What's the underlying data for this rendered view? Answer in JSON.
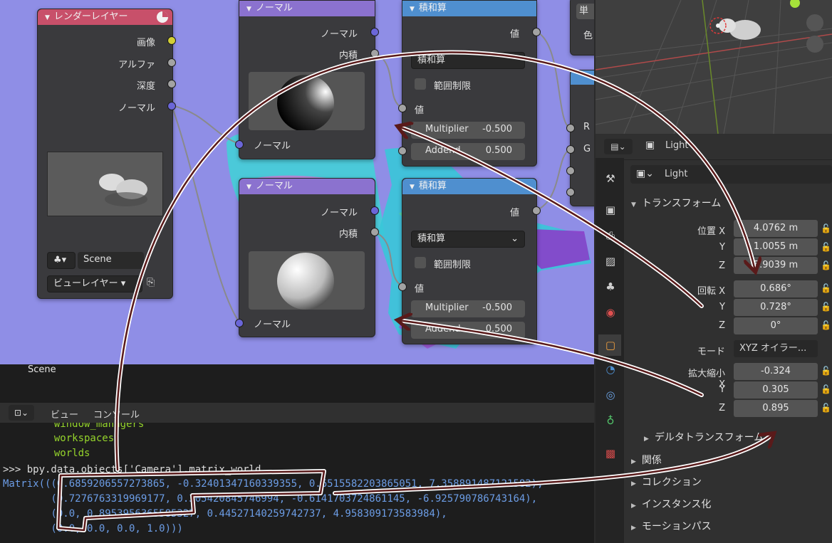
{
  "nodes": {
    "render_layer": {
      "title": "レンダーレイヤー",
      "outputs": [
        "画像",
        "アルファ",
        "深度",
        "ノーマル"
      ],
      "scene": "Scene",
      "view_layer": "ビューレイヤー"
    },
    "normal_top": {
      "title": "ノーマル",
      "outputs": [
        "ノーマル",
        "内積"
      ],
      "input": "ノーマル"
    },
    "normal_bottom": {
      "title": "ノーマル",
      "outputs": [
        "ノーマル",
        "内積"
      ],
      "input": "ノーマル"
    },
    "multiply_add_top": {
      "title": "積和算",
      "output": "値",
      "operation": "積和算",
      "clamp": "範囲制限",
      "input": "値",
      "multiplier_label": "Multiplier",
      "multiplier_value": "-0.500",
      "addend_label": "Addend",
      "addend_value": "0.500"
    },
    "multiply_add_bottom": {
      "title": "積和算",
      "output": "値",
      "operation": "積和算",
      "clamp": "範囲制限",
      "input": "値",
      "multiplier_label": "Multiplier",
      "multiplier_value": "-0.500",
      "addend_label": "Addend",
      "addend_value": "0.500"
    },
    "partial_right": {
      "label1": "単",
      "label2": "色",
      "r": "R",
      "g": "G"
    }
  },
  "node_editor_footer": "Scene",
  "console": {
    "menu": [
      "ビュー",
      "コンソール"
    ],
    "lines": [
      {
        "text": "         window_managers",
        "color": "green"
      },
      {
        "text": "         workspaces",
        "color": "green"
      },
      {
        "text": "         worlds",
        "color": "green"
      },
      {
        "text": ">>> bpy.data.objects['Camera'].matrix_world",
        "color": "white"
      },
      {
        "text": "Matrix(((0.6859206557273865, -0.32401347160339355, 0.6515582203865051, 7.358891487121582),",
        "color": "blue"
      },
      {
        "text": "        (0.7276763319969177, 0.305420845746994, -0.6141703724861145, -6.925790786743164),",
        "color": "blue"
      },
      {
        "text": "        (0.0, 0.8953956365585327, 0.4452714025974273​7, 4.958309173583984),",
        "color": "blue"
      },
      {
        "text": "        (0.0, 0.0, 0.0, 1.0)))",
        "color": "blue"
      }
    ]
  },
  "properties": {
    "header_object": "Light",
    "object_name": "Light",
    "transform_title": "トランスフォーム",
    "location_label": "位置",
    "rotation_label": "回転",
    "scale_label": "拡大縮小",
    "axis": [
      "X",
      "Y",
      "Z"
    ],
    "location": [
      "4.0762 m",
      "1.0055 m",
      "5.9039 m"
    ],
    "rotation": [
      "0.686°",
      "0.728°",
      "0°"
    ],
    "mode_label": "モード",
    "mode_value": "XYZ オイラー...",
    "scale": [
      "-0.324",
      "0.305",
      "0.895"
    ],
    "delta": "デルタトランスフォーム",
    "sections": [
      "関係",
      "コレクション",
      "インスタンス化",
      "モーションパス"
    ]
  }
}
